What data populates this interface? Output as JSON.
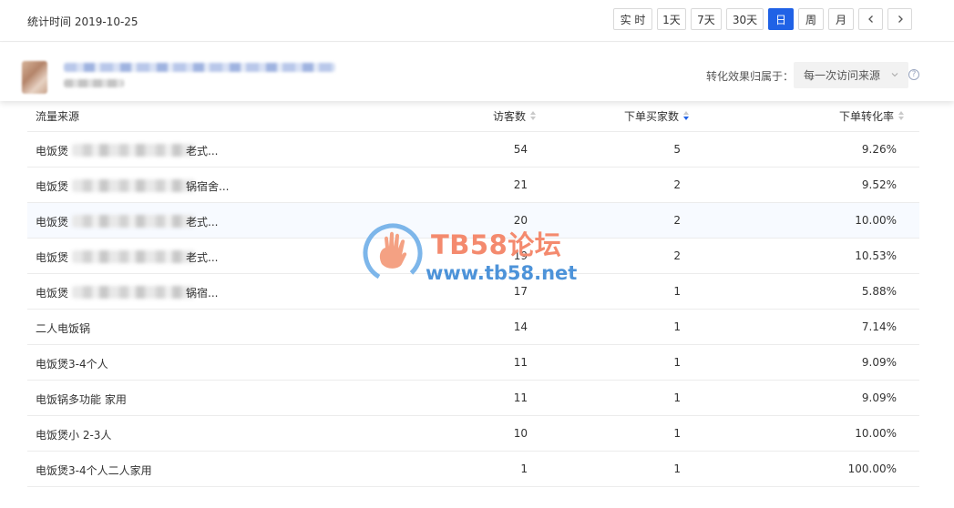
{
  "header": {
    "stat_time": "统计时间 2019-10-25",
    "controls": [
      {
        "label": "实 时",
        "active": false
      },
      {
        "label": "1天",
        "active": false
      },
      {
        "label": "7天",
        "active": false
      },
      {
        "label": "30天",
        "active": false
      },
      {
        "label": "日",
        "active": true
      },
      {
        "label": "周",
        "active": false
      },
      {
        "label": "月",
        "active": false
      }
    ],
    "prev_icon": "chevron-left-icon",
    "next_icon": "chevron-right-icon",
    "accent_color": "#2062e6"
  },
  "product": {
    "attribution_label": "转化效果归属于：",
    "attribution_value": "每一次访问来源",
    "help_icon": "question-circle-icon"
  },
  "table": {
    "columns": [
      "流量来源",
      "访客数",
      "下单买家数",
      "下单转化率"
    ],
    "sort_column": "下单买家数",
    "sort_order": "desc",
    "rows": [
      {
        "source": "电饭煲",
        "tail": "老式...",
        "visitors": "54",
        "buyers": "5",
        "rate": "9.26%"
      },
      {
        "source": "电饭煲",
        "tail": "锅宿舍...",
        "visitors": "21",
        "buyers": "2",
        "rate": "9.52%"
      },
      {
        "source": "电饭煲",
        "tail": "老式...",
        "visitors": "20",
        "buyers": "2",
        "rate": "10.00%"
      },
      {
        "source": "电饭煲",
        "tail": "老式...",
        "visitors": "19",
        "buyers": "2",
        "rate": "10.53%"
      },
      {
        "source": "电饭煲",
        "tail": "锅宿...",
        "visitors": "17",
        "buyers": "1",
        "rate": "5.88%"
      },
      {
        "source": "二人电饭锅",
        "tail": "",
        "visitors": "14",
        "buyers": "1",
        "rate": "7.14%"
      },
      {
        "source": "电饭煲3-4个人",
        "tail": "",
        "visitors": "11",
        "buyers": "1",
        "rate": "9.09%"
      },
      {
        "source": "电饭锅多功能 家用",
        "tail": "",
        "visitors": "11",
        "buyers": "1",
        "rate": "9.09%"
      },
      {
        "source": "电饭煲小 2-3人",
        "tail": "",
        "visitors": "10",
        "buyers": "1",
        "rate": "10.00%"
      },
      {
        "source": "电饭煲3-4个人二人家用",
        "tail": "",
        "visitors": "1",
        "buyers": "1",
        "rate": "100.00%"
      }
    ]
  },
  "watermark": {
    "title": "TB58论坛",
    "url": "www.tb58.net",
    "title_color": "#f48a6e",
    "url_color": "#4d93d9"
  }
}
